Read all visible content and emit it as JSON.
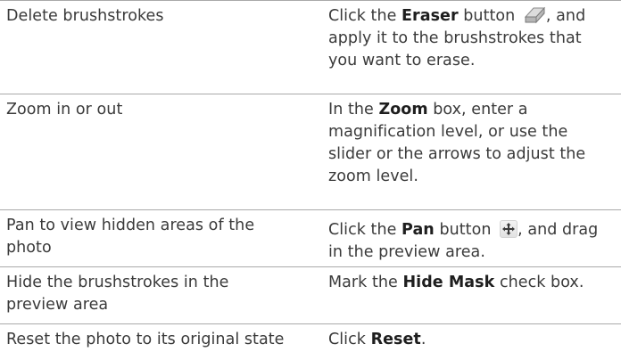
{
  "rows": [
    {
      "task": "Delete brushstrokes",
      "desc": {
        "pre": "Click the ",
        "bold": "Eraser",
        "mid": " button",
        "post_line1": ", and",
        "line2": "apply it to the brushstrokes that",
        "line3": "you want to erase.",
        "icon": "eraser-icon"
      }
    },
    {
      "task": "Zoom in or out",
      "desc": {
        "pre": "In the ",
        "bold": "Zoom",
        "post_line1": " box, enter a",
        "line2": "magnification level, or use the",
        "line3": "slider or the arrows to adjust the",
        "line4": "zoom level."
      }
    },
    {
      "task_line1": "Pan to view hidden areas of the",
      "task_line2": "photo",
      "desc": {
        "pre": "Click the ",
        "bold": "Pan",
        "mid": " button",
        "post_line1": ", and drag",
        "line2": "in the preview area.",
        "icon": "pan-move-icon"
      }
    },
    {
      "task_line1": "Hide the brushstrokes in the",
      "task_line2": "preview area",
      "desc": {
        "pre": "Mark the ",
        "bold": "Hide Mask",
        "post_line1": " check box."
      }
    },
    {
      "task": "Reset the photo to its original state",
      "desc": {
        "pre": "Click ",
        "bold": "Reset",
        "post_line1": "."
      }
    }
  ],
  "colors": {
    "rule": "#a9a9a9",
    "text": "#3a3a3a",
    "bold_text": "#1e1e1e"
  }
}
